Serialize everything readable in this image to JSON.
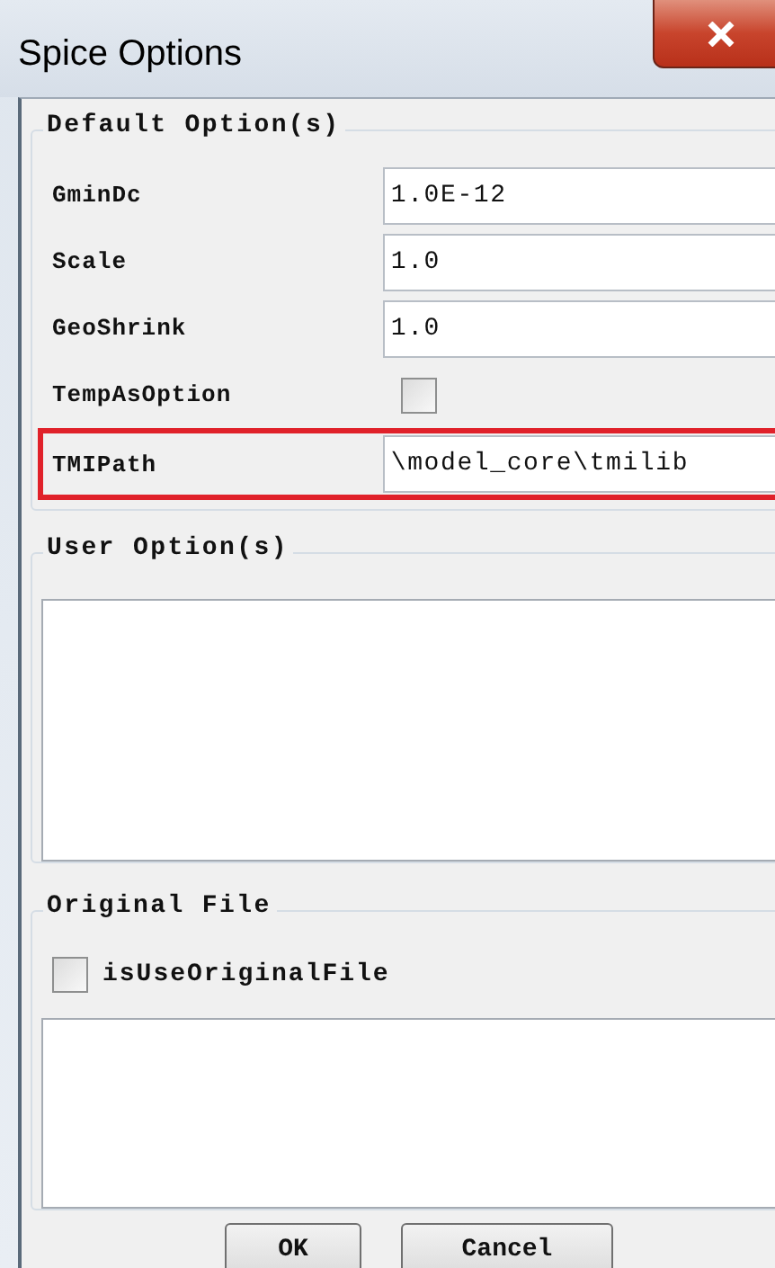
{
  "window": {
    "title": "Spice Options"
  },
  "default_options": {
    "title": "Default Option(s)",
    "rows": [
      {
        "label": "GminDc",
        "kind": "text",
        "value": "1.0E-12",
        "highlighted": false
      },
      {
        "label": "Scale",
        "kind": "text",
        "value": "1.0",
        "highlighted": false
      },
      {
        "label": "GeoShrink",
        "kind": "text",
        "value": "1.0",
        "highlighted": false
      },
      {
        "label": "TempAsOption",
        "kind": "checkbox",
        "checked": false,
        "highlighted": false
      },
      {
        "label": "TMIPath",
        "kind": "text",
        "value": "\\model_core\\tmilib",
        "highlighted": true
      }
    ]
  },
  "user_options": {
    "title": "User Option(s)"
  },
  "original_file": {
    "title": "Original File",
    "checkbox": {
      "label": "isUseOriginalFile",
      "checked": false
    }
  },
  "buttons": [
    "OK",
    "Cancel"
  ]
}
